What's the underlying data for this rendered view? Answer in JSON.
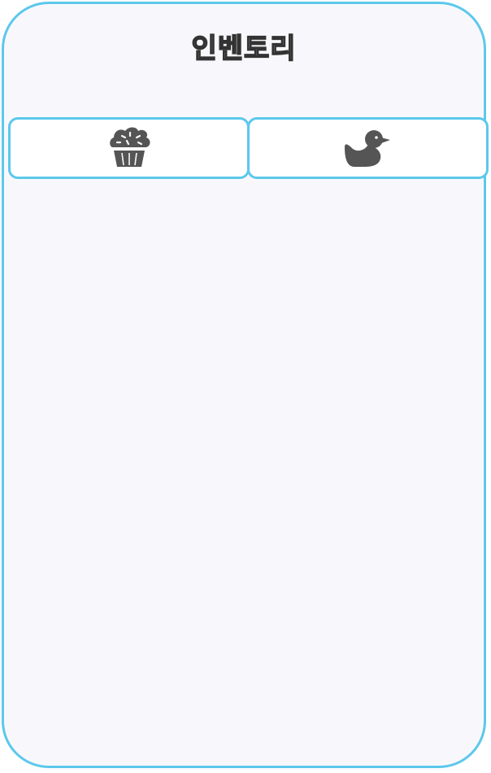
{
  "inventory": {
    "title": "인벤토리",
    "tabs": [
      {
        "icon": "cupcake-icon"
      },
      {
        "icon": "duck-icon"
      }
    ],
    "colors": {
      "border": "#5cc8ec",
      "panel_bg": "#f8f8fc",
      "icon": "#555555"
    }
  }
}
